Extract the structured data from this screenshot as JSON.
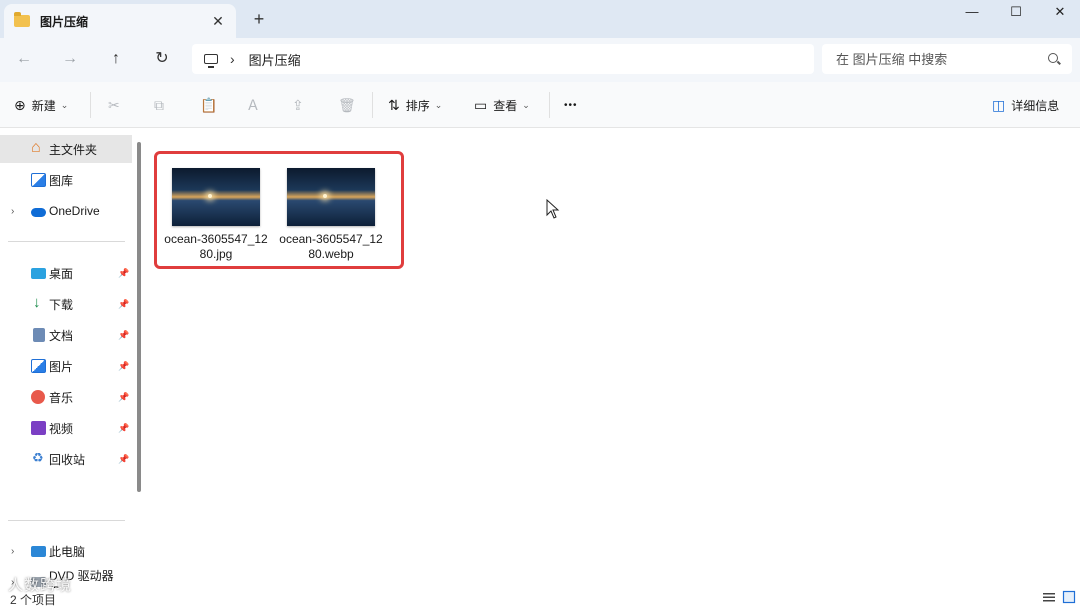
{
  "window": {
    "tab_title": "图片压缩",
    "tab_close": "✕",
    "new_tab": "+",
    "minimize": "—",
    "maximize": "☐",
    "close": "✕"
  },
  "nav": {
    "back": "←",
    "forward": "→",
    "up": "↑",
    "refresh": "↻"
  },
  "address": {
    "chevron": "›",
    "path": "图片压缩"
  },
  "search": {
    "placeholder": "在 图片压缩 中搜索"
  },
  "commands": {
    "new_label": "新建",
    "sort_label": "排序",
    "view_label": "查看",
    "more": "•••",
    "details_label": "详细信息",
    "cut": "✂",
    "copy": "⧉",
    "paste": "📋",
    "rename": "Ａ",
    "share": "⇪",
    "delete": "🗑",
    "plus_icon": "⊕",
    "sort_icon": "⇅",
    "view_icon": "▭",
    "details_icon": "◫",
    "dropdown": "⌄"
  },
  "sidebar": {
    "quick": [
      {
        "label": "主文件夹"
      },
      {
        "label": "图库"
      },
      {
        "label": "OneDrive"
      }
    ],
    "pinned": [
      {
        "label": "桌面"
      },
      {
        "label": "下载"
      },
      {
        "label": "文档"
      },
      {
        "label": "图片"
      },
      {
        "label": "音乐"
      },
      {
        "label": "视频"
      },
      {
        "label": "回收站"
      }
    ],
    "devices": [
      {
        "label": "此电脑"
      },
      {
        "label": "DVD 驱动器 (D:"
      }
    ],
    "expand_arrow": "›",
    "pin_glyph": "📌"
  },
  "files": [
    {
      "name": "ocean-3605547_1280.jpg"
    },
    {
      "name": "ocean-3605547_1280.webp"
    }
  ],
  "status": {
    "count": "2 个项目"
  },
  "watermark": {
    "text": "人数跨境"
  },
  "colors": {
    "accent_highlight": "#e03d3d",
    "titlebar": "#dfe8f3",
    "selection": "#e6e6e6"
  }
}
